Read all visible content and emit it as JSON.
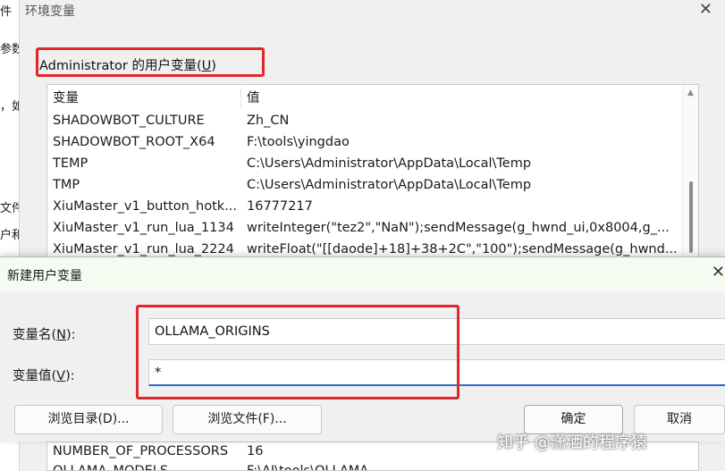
{
  "background_window": {
    "fragments": [
      "件",
      "参数",
      "，如",
      "文件",
      "户和"
    ]
  },
  "env_dialog": {
    "title": "环境变量",
    "close_glyph": "✕",
    "user_vars_label": "Administrator 的用户变量(",
    "user_vars_hotkey": "U",
    "user_vars_suffix": ")",
    "columns": [
      "变量",
      "值"
    ],
    "rows": [
      {
        "name": "SHADOWBOT_CULTURE",
        "value": "Zh_CN"
      },
      {
        "name": "SHADOWBOT_ROOT_X64",
        "value": "F:\\tools\\yingdao"
      },
      {
        "name": "TEMP",
        "value": "C:\\Users\\Administrator\\AppData\\Local\\Temp"
      },
      {
        "name": "TMP",
        "value": "C:\\Users\\Administrator\\AppData\\Local\\Temp"
      },
      {
        "name": "XiuMaster_v1_button_hotk...",
        "value": "16777217"
      },
      {
        "name": "XiuMaster_v1_run_lua_1134",
        "value": "writeInteger(\"tez2\",\"NaN\");sendMessage(g_hwnd_ui,0x8004,g_..."
      },
      {
        "name": "XiuMaster_v1_run_lua_2224",
        "value": "writeFloat(\"[[daode]+18]+38+2C\",\"100\");sendMessage(g_hwnd..."
      }
    ],
    "lower_rows": [
      {
        "name": "NUMBER_OF_PROCESSORS",
        "value": "16"
      },
      {
        "name": "OLLAMA_MODELS",
        "value": "F:\\AI\\tools\\OLLAMA"
      }
    ]
  },
  "new_var_dialog": {
    "title": "新建用户变量",
    "close_glyph": "✕",
    "name_label": "变量名(",
    "name_hotkey": "N",
    "name_suffix": "):",
    "name_value": "OLLAMA_ORIGINS",
    "value_label": "变量值(",
    "value_hotkey": "V",
    "value_suffix": "):",
    "value_value": "*",
    "buttons": {
      "browse_dir": "浏览目录(D)...",
      "browse_file": "浏览文件(F)...",
      "ok": "确定",
      "cancel": "取消"
    }
  },
  "watermark": "知乎 @潇洒的程序猿",
  "colors": {
    "highlight": "#e3262b",
    "focus_underline": "#2d6cc0",
    "dialog_bg": "#f0f0f0"
  }
}
